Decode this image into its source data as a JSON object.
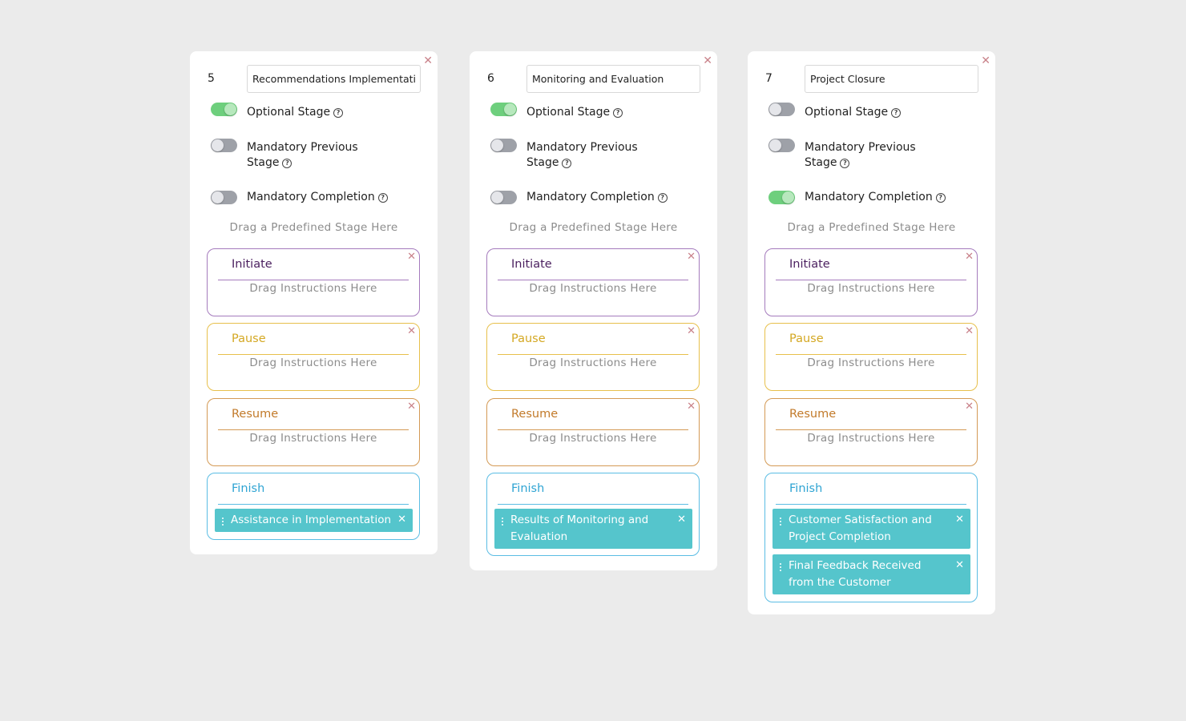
{
  "cards": [
    {
      "number": "5",
      "name": "Recommendations Implementation",
      "toggles": {
        "optional": {
          "label": "Optional Stage",
          "on": true
        },
        "mandatory_previous": {
          "label_line1": "Mandatory Previous",
          "label_line2": "Stage",
          "on": false
        },
        "mandatory_completion": {
          "label": "Mandatory Completion",
          "on": false
        }
      },
      "drop_hint": "Drag a Predefined Stage Here",
      "boxes": {
        "initiate": {
          "title": "Initiate",
          "hint": "Drag Instructions Here"
        },
        "pause": {
          "title": "Pause",
          "hint": "Drag Instructions Here"
        },
        "resume": {
          "title": "Resume",
          "hint": "Drag Instructions Here"
        },
        "finish": {
          "title": "Finish",
          "items": [
            "Assistance in Implementation"
          ]
        }
      }
    },
    {
      "number": "6",
      "name": "Monitoring and Evaluation",
      "toggles": {
        "optional": {
          "label": "Optional Stage",
          "on": true
        },
        "mandatory_previous": {
          "label_line1": "Mandatory Previous",
          "label_line2": "Stage",
          "on": false
        },
        "mandatory_completion": {
          "label": "Mandatory Completion",
          "on": false
        }
      },
      "drop_hint": "Drag a Predefined Stage Here",
      "boxes": {
        "initiate": {
          "title": "Initiate",
          "hint": "Drag Instructions Here"
        },
        "pause": {
          "title": "Pause",
          "hint": "Drag Instructions Here"
        },
        "resume": {
          "title": "Resume",
          "hint": "Drag Instructions Here"
        },
        "finish": {
          "title": "Finish",
          "items": [
            "Results of Monitoring and Evaluation"
          ]
        }
      }
    },
    {
      "number": "7",
      "name": "Project Closure",
      "toggles": {
        "optional": {
          "label": "Optional Stage",
          "on": false
        },
        "mandatory_previous": {
          "label_line1": "Mandatory Previous",
          "label_line2": "Stage",
          "on": false
        },
        "mandatory_completion": {
          "label": "Mandatory Completion",
          "on": true
        }
      },
      "drop_hint": "Drag a Predefined Stage Here",
      "boxes": {
        "initiate": {
          "title": "Initiate",
          "hint": "Drag Instructions Here"
        },
        "pause": {
          "title": "Pause",
          "hint": "Drag Instructions Here"
        },
        "resume": {
          "title": "Resume",
          "hint": "Drag Instructions Here"
        },
        "finish": {
          "title": "Finish",
          "items": [
            "Customer Satisfaction and Project Completion",
            "Final Feedback Received from the Customer"
          ]
        }
      }
    }
  ],
  "icons": {
    "close": "close-icon",
    "help": "help-circle-icon",
    "grip": "drag-handle-icon"
  },
  "colors": {
    "toggle_on": "#6ecf7d",
    "toggle_off": "#9ea1a8",
    "initiate": "#a57bbd",
    "pause": "#e7c04c",
    "resume": "#d49a55",
    "finish": "#5bbde4",
    "chip": "#55c5cc",
    "close": "#c9828a"
  }
}
